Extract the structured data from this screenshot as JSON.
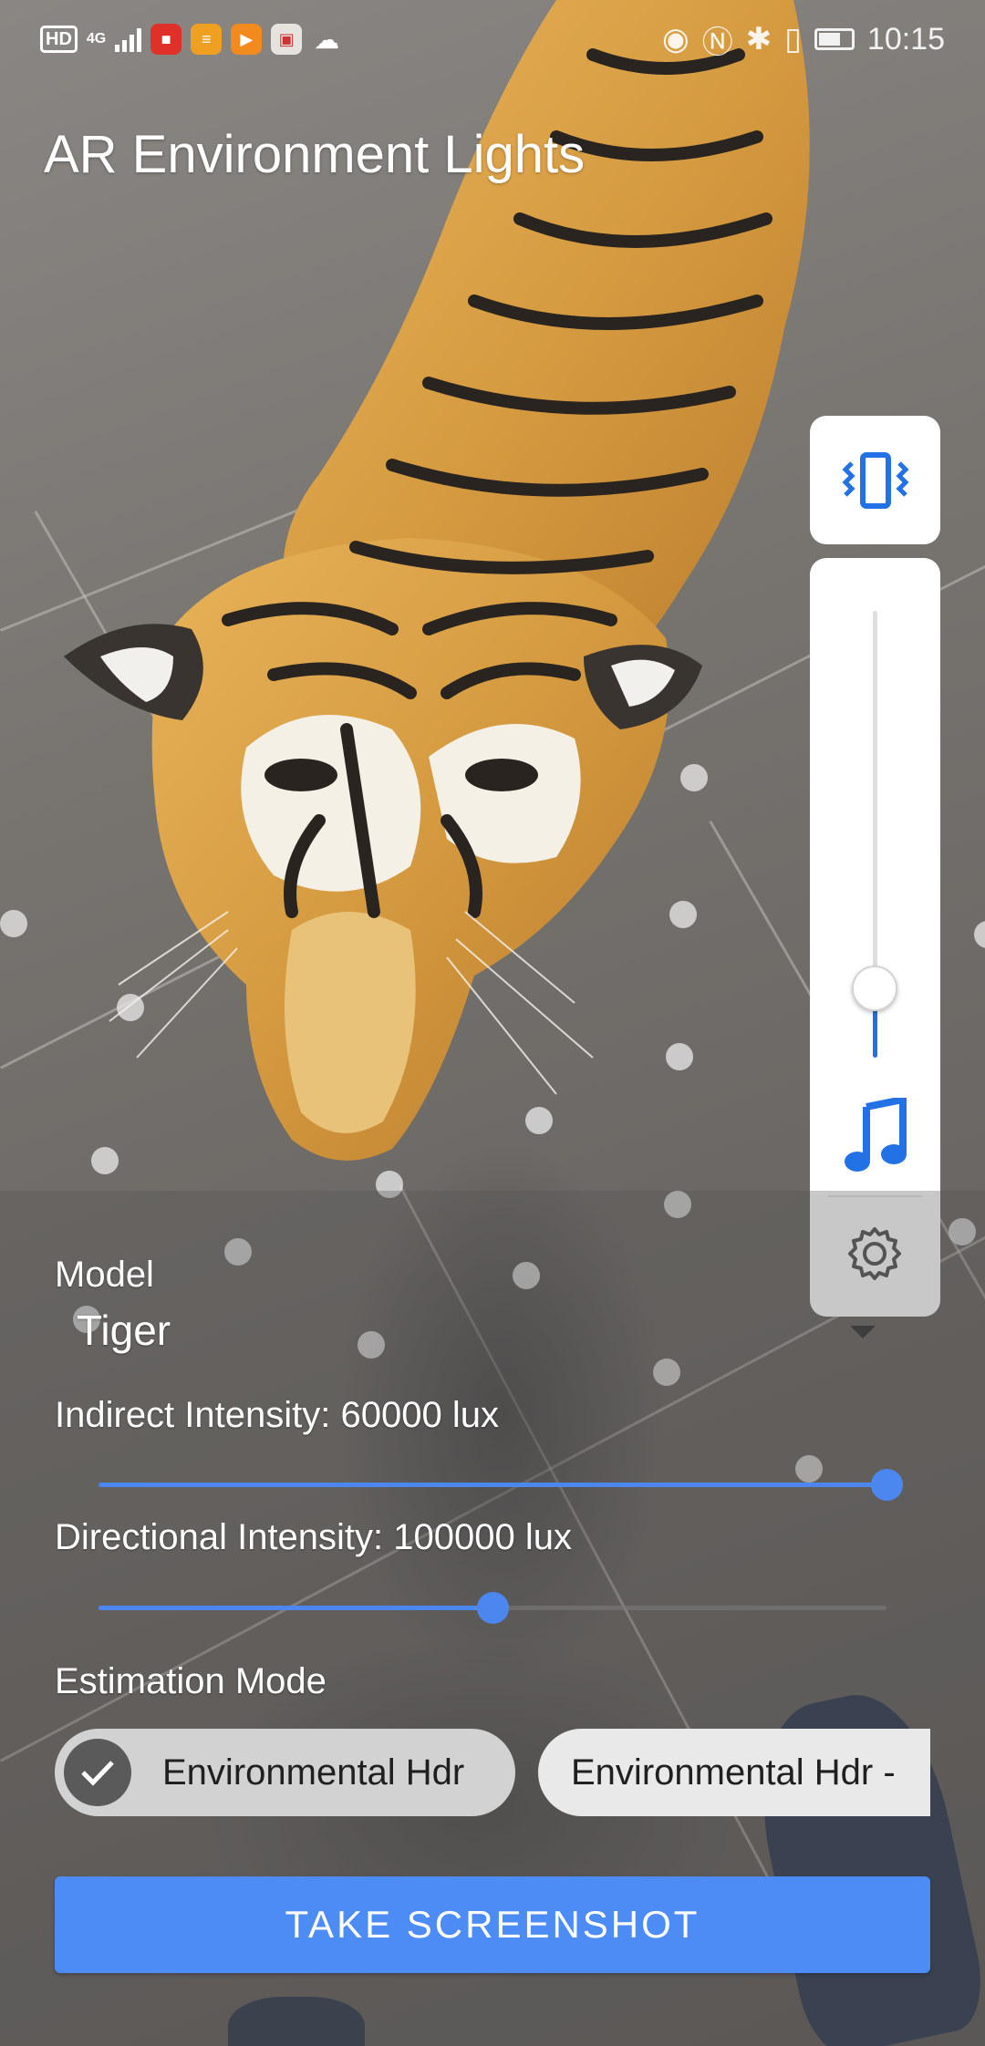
{
  "status_bar": {
    "hd_badge": "HD",
    "network": "4G",
    "time": "10:15",
    "icons": [
      "video-app-icon",
      "news-app-icon",
      "player-app-icon",
      "gift-app-icon",
      "wechat-icon",
      "eye-icon",
      "nfc-icon",
      "bluetooth-icon",
      "vibrate-icon",
      "battery-icon"
    ]
  },
  "title": "AR Environment Lights",
  "controls": {
    "model_label": "Model",
    "model_value": "Tiger",
    "indirect_label": "Indirect Intensity: 60000 lux",
    "indirect_level": 1.0,
    "directional_label": "Directional Intensity: 100000 lux",
    "directional_level": 0.5,
    "estimation_label": "Estimation Mode",
    "modes": [
      {
        "label": "Environmental Hdr",
        "selected": true
      },
      {
        "label": "Environmental Hdr -",
        "selected": false
      }
    ],
    "screenshot_button": "TAKE SCREENSHOT"
  },
  "volume_panel": {
    "level": 0.15,
    "accent": "#2272e6",
    "icons": [
      "vibrate-mode-icon",
      "music-note-icon",
      "settings-gear-icon",
      "collapse-caret-icon"
    ]
  },
  "colors": {
    "accent": "#4b87ee",
    "button": "#4d8cf5"
  }
}
